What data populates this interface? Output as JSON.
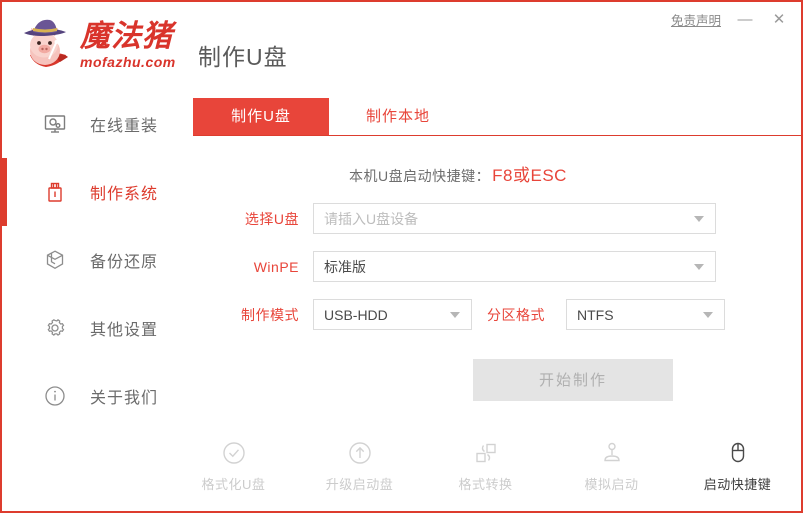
{
  "window": {
    "brand_cn": "魔法猪",
    "brand_en": "mofazhu.com",
    "page_title": "制作U盘",
    "disclaimer": "免责声明",
    "minimize": "—",
    "close": "✕",
    "accent_color": "#dd3c2e",
    "tab_active_color": "#e8453a"
  },
  "sidebar": {
    "items": [
      {
        "label": "在线重装",
        "icon": "monitor-icon",
        "active": false
      },
      {
        "label": "制作系统",
        "icon": "usb-drive-icon",
        "active": true
      },
      {
        "label": "备份还原",
        "icon": "backup-box-icon",
        "active": false
      },
      {
        "label": "其他设置",
        "icon": "gear-icon",
        "active": false
      },
      {
        "label": "关于我们",
        "icon": "info-icon",
        "active": false
      }
    ]
  },
  "main": {
    "tabs": [
      {
        "label": "制作U盘",
        "active": true
      },
      {
        "label": "制作本地",
        "active": false
      }
    ],
    "notice": {
      "label": "本机U盘启动快捷键：",
      "key": "F8或ESC"
    },
    "form": {
      "usb": {
        "label": "选择U盘",
        "placeholder": "请插入U盘设备",
        "value": ""
      },
      "winpe": {
        "label": "WinPE",
        "value": "标准版"
      },
      "mode": {
        "label": "制作模式",
        "value": "USB-HDD"
      },
      "partition": {
        "label": "分区格式",
        "value": "NTFS"
      }
    },
    "start_button": {
      "label": "开始制作",
      "disabled": true
    }
  },
  "tools": [
    {
      "label": "格式化U盘",
      "icon": "check-circle-icon",
      "enabled": false
    },
    {
      "label": "升级启动盘",
      "icon": "arrow-up-circle-icon",
      "enabled": false
    },
    {
      "label": "格式转换",
      "icon": "convert-icon",
      "enabled": false
    },
    {
      "label": "模拟启动",
      "icon": "joystick-icon",
      "enabled": false
    },
    {
      "label": "启动快捷键",
      "icon": "mouse-icon",
      "enabled": true
    }
  ]
}
